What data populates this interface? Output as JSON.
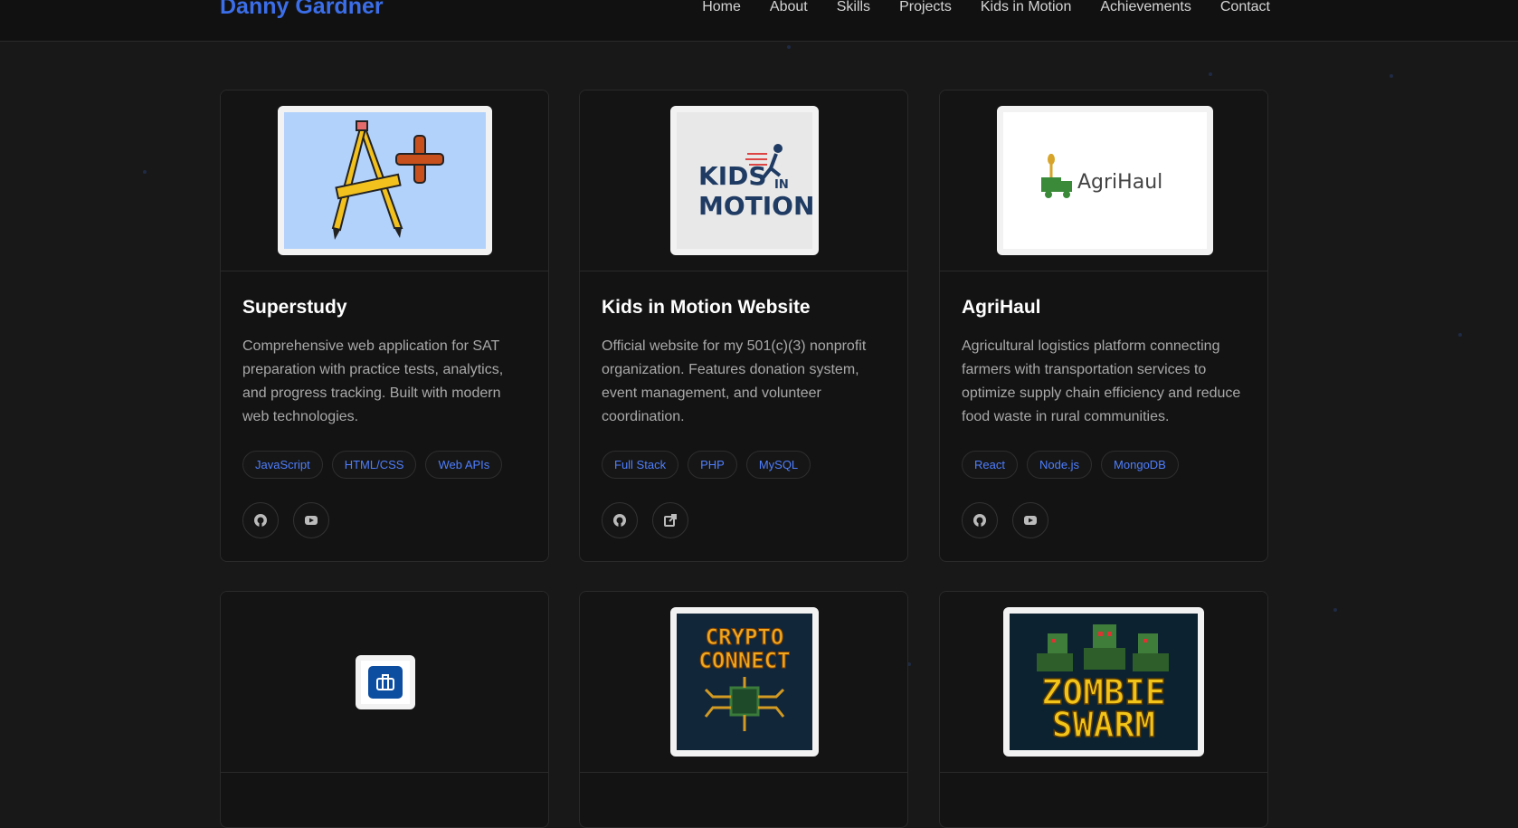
{
  "brand": "Danny Gardner",
  "nav": [
    "Home",
    "About",
    "Skills",
    "Projects",
    "Kids in Motion",
    "Achievements",
    "Contact"
  ],
  "thumbs": {
    "superstudy": "A+",
    "kids_motion_1": "KIDS",
    "kids_motion_2": "IN",
    "kids_motion_3": "MOTION",
    "agrihaul": "AgriHaul",
    "crypto_1": "CRYPTO",
    "crypto_2": "CONNECT",
    "zombie_1": "ZOMBIE",
    "zombie_2": "SWARM"
  },
  "projects": [
    {
      "title": "Superstudy",
      "description": "Comprehensive web application for SAT preparation with practice tests, analytics, and progress tracking. Built with modern web technologies.",
      "tags": [
        "JavaScript",
        "HTML/CSS",
        "Web APIs"
      ],
      "link_icons": [
        "github-icon",
        "youtube-icon"
      ]
    },
    {
      "title": "Kids in Motion Website",
      "description": "Official website for my 501(c)(3) nonprofit organization. Features donation system, event management, and volunteer coordination.",
      "tags": [
        "Full Stack",
        "PHP",
        "MySQL"
      ],
      "link_icons": [
        "github-icon",
        "external-link-icon"
      ]
    },
    {
      "title": "AgriHaul",
      "description": "Agricultural logistics platform connecting farmers with transportation services to optimize supply chain efficiency and reduce food waste in rural communities.",
      "tags": [
        "React",
        "Node.js",
        "MongoDB"
      ],
      "link_icons": [
        "github-icon",
        "youtube-icon"
      ]
    }
  ],
  "colors": {
    "background": "#181818",
    "brand": "#3b6ee8",
    "tag_text": "#4f7fff",
    "card": "#131313"
  }
}
